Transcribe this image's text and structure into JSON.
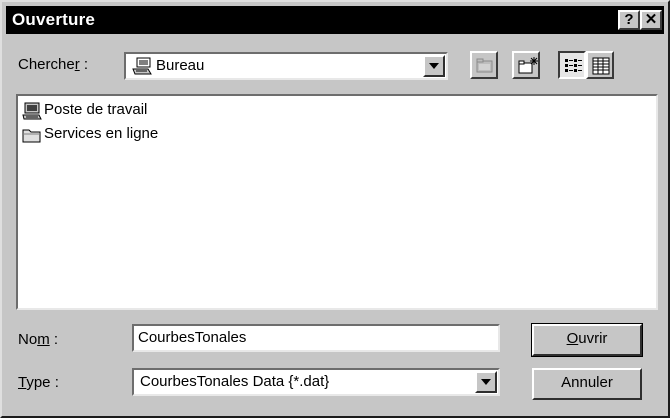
{
  "window": {
    "title": "Ouverture",
    "help_label": "?",
    "close_label": "✕"
  },
  "lookin": {
    "label_pre": "Cherche",
    "label_ul": "r",
    "label_post": " :",
    "value": "Bureau",
    "icon": "desktop-icon"
  },
  "toolbar": {
    "up_icon": "up-folder-icon",
    "newfolder_icon": "new-folder-icon",
    "list_icon": "list-view-icon",
    "details_icon": "details-view-icon"
  },
  "files": [
    {
      "name": "Poste de travail",
      "icon": "computer-icon"
    },
    {
      "name": "Services en ligne",
      "icon": "folder-icon"
    }
  ],
  "filename": {
    "label_pre": "No",
    "label_ul": "m",
    "label_post": " :",
    "value": "CourbesTonales"
  },
  "filetype": {
    "label_ul": "T",
    "label_post": "ype :",
    "value": "CourbesTonales Data {*.dat}"
  },
  "buttons": {
    "open_ul": "O",
    "open_rest": "uvrir",
    "cancel": "Annuler"
  },
  "colors": {
    "face": "#c6c6c6",
    "title_bg": "#000000",
    "title_fg": "#ffffff"
  }
}
